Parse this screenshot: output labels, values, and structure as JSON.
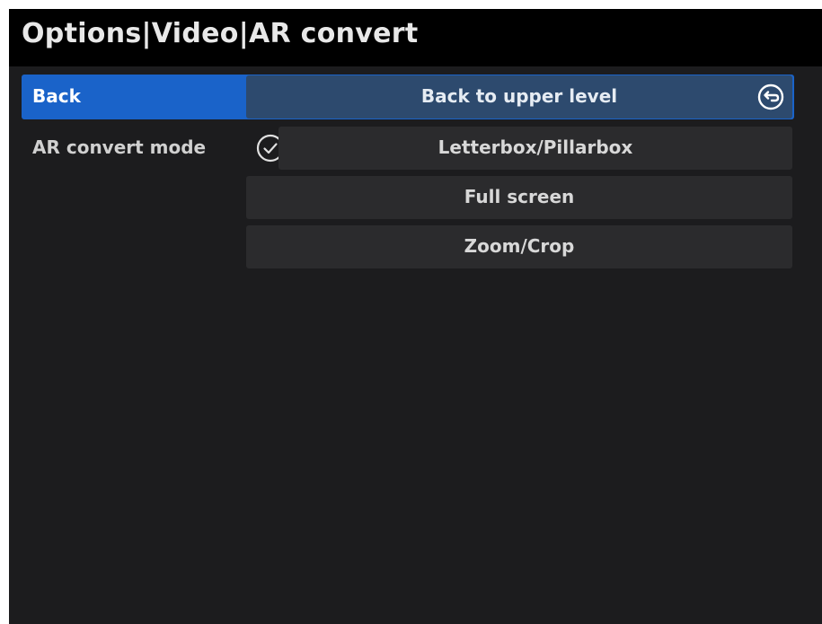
{
  "header": {
    "title": "Options|Video|AR convert"
  },
  "menu": {
    "back": {
      "label": "Back",
      "value": "Back to upper level",
      "icon": "back-arrow-icon"
    },
    "ar_convert_mode": {
      "label": "AR convert mode",
      "selected": "Letterbox/Pillarbox",
      "options": [
        "Letterbox/Pillarbox",
        "Full screen",
        "Zoom/Crop"
      ],
      "check_icon": "checkmark-circle-icon"
    }
  },
  "colors": {
    "highlight": "#1a63c9",
    "background": "#1c1c1e",
    "titlebar": "#000000",
    "option_bg": "#2b2b2d"
  }
}
